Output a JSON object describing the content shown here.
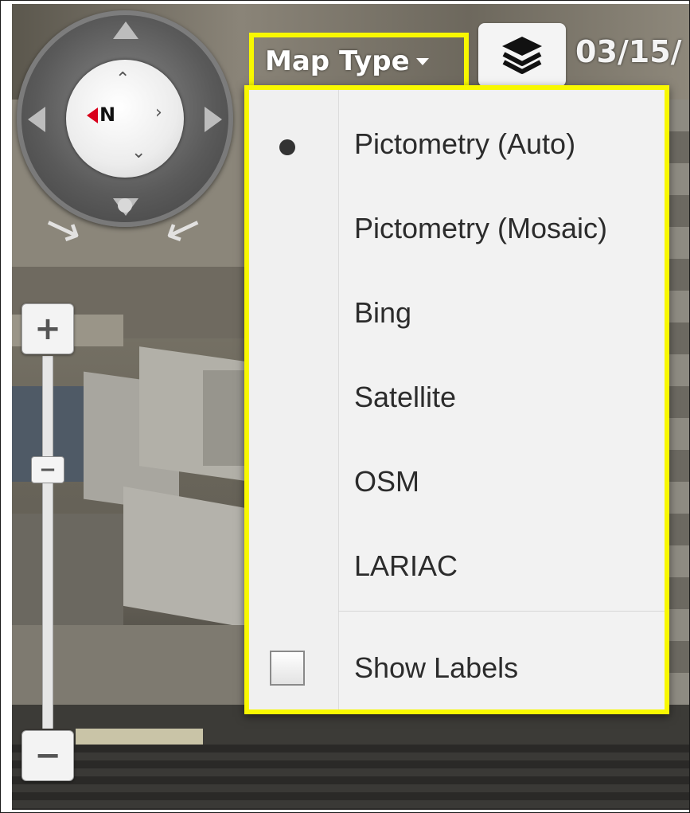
{
  "toolbar": {
    "map_type_label": "Map Type",
    "layers_icon": "layers-icon",
    "date_text": "03/15/"
  },
  "compass": {
    "north_label": "N",
    "icon": "compass-icon"
  },
  "zoom": {
    "in_label": "+",
    "out_label": "−",
    "thumb_label": "−"
  },
  "map_type_menu": {
    "selected_index": 0,
    "items": [
      {
        "label": "Pictometry (Auto)",
        "selected": true
      },
      {
        "label": "Pictometry (Mosaic)",
        "selected": false
      },
      {
        "label": "Bing",
        "selected": false
      },
      {
        "label": "Satellite",
        "selected": false
      },
      {
        "label": "OSM",
        "selected": false
      },
      {
        "label": "LARIAC",
        "selected": false
      }
    ],
    "show_labels": {
      "label": "Show Labels",
      "checked": false
    }
  },
  "colors": {
    "highlight": "#f8f800",
    "menu_background": "#f2f2f2",
    "menu_text": "#2c2c2c",
    "north_arrow": "#d9001b"
  }
}
